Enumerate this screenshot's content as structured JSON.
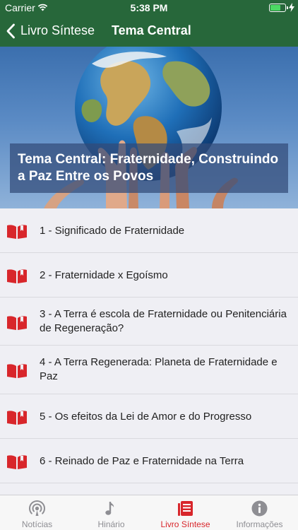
{
  "status_bar": {
    "carrier": "Carrier",
    "time": "5:38 PM"
  },
  "nav": {
    "back_label": "Livro Síntese",
    "title": "Tema Central"
  },
  "hero": {
    "caption": "Tema Central: Fraternidade, Construindo a Paz Entre os Povos"
  },
  "chapters": [
    {
      "label": "1 - Significado de Fraternidade"
    },
    {
      "label": "2 - Fraternidade x Egoísmo"
    },
    {
      "label": "3 - A Terra é escola de Fraternidade ou Penitenciária de Regeneração?"
    },
    {
      "label": "4 - A Terra Regenerada: Planeta de Fraternidade e Paz"
    },
    {
      "label": "5 - Os efeitos da Lei de Amor e do Progresso"
    },
    {
      "label": "6 - Reinado de Paz e Fraternidade na Terra"
    }
  ],
  "tabs": [
    {
      "label": "Notícias",
      "icon": "broadcast-icon"
    },
    {
      "label": "Hinário",
      "icon": "music-note-icon"
    },
    {
      "label": "Livro Síntese",
      "icon": "book-list-icon",
      "active": true
    },
    {
      "label": "Informações",
      "icon": "info-icon"
    }
  ],
  "colors": {
    "nav_green": "#27673a",
    "accent_red": "#d8262b",
    "battery_green": "#4cd964"
  }
}
